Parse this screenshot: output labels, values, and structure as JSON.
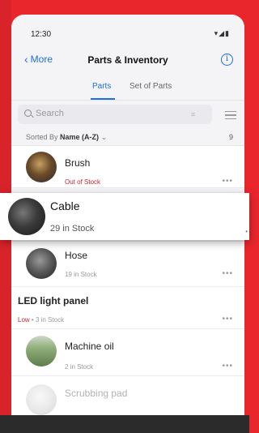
{
  "status": {
    "time": "12:30",
    "icons": "▾◢▮"
  },
  "nav": {
    "back_label": "More",
    "title": "Parts & Inventory",
    "info_glyph": "i"
  },
  "tabs": [
    {
      "label": "Parts",
      "active": true
    },
    {
      "label": "Set of Parts",
      "active": false
    }
  ],
  "search": {
    "placeholder": "Search",
    "scan_glyph": "⌗"
  },
  "sort": {
    "prefix": "Sorted By",
    "value": "Name (A-Z)",
    "chevron": "⌄",
    "count": "9"
  },
  "items": [
    {
      "name": "Brush",
      "stock": "Out of Stock",
      "status": "out"
    },
    {
      "name": "Hose",
      "stock": "19 in Stock"
    },
    {
      "name": "LED light panel",
      "low_label": "Low",
      "stock": "3 in Stock"
    },
    {
      "name": "Machine oil",
      "stock": "2 in Stock"
    },
    {
      "name": "Scrubbing pad",
      "stock": ""
    }
  ],
  "dragging_item": {
    "name": "Cable",
    "stock": "29 in Stock"
  },
  "more_glyph": "•••",
  "colors": {
    "accent": "#1f6fe0",
    "alert": "#d32030",
    "brand_red": "#e8262c"
  }
}
